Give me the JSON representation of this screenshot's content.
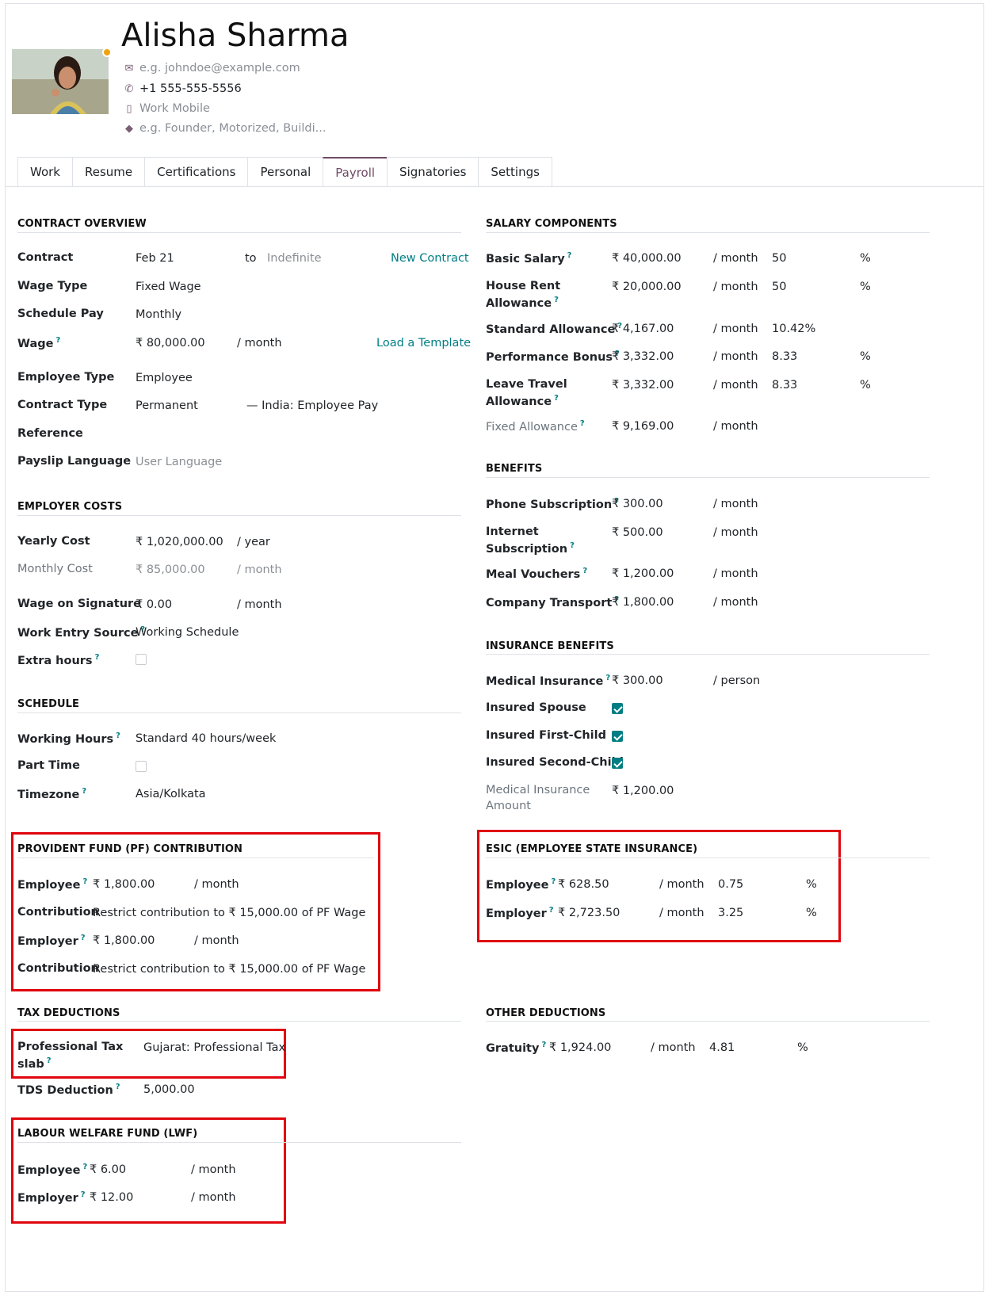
{
  "employee": {
    "name": "Alisha Sharma",
    "email_placeholder": "e.g. johndoe@example.com",
    "phone": "+1 555-555-5556",
    "mobile_placeholder": "Work Mobile",
    "tags_placeholder": "e.g. Founder, Motorized, Buildi..."
  },
  "tabs": [
    "Work",
    "Resume",
    "Certifications",
    "Personal",
    "Payroll",
    "Signatories",
    "Settings"
  ],
  "active_tab": "Payroll",
  "contract_overview": {
    "title": "CONTRACT OVERVIEW",
    "contract_label": "Contract",
    "contract_start": "Feb 21",
    "to": "to",
    "contract_end": "Indefinite",
    "new_contract": "New Contract",
    "wage_type_label": "Wage Type",
    "wage_type": "Fixed Wage",
    "schedule_pay_label": "Schedule Pay",
    "schedule_pay": "Monthly",
    "wage_label": "Wage",
    "wage": "₹ 80,000.00",
    "wage_unit": "/ month",
    "load_template": "Load a Template",
    "employee_type_label": "Employee Type",
    "employee_type": "Employee",
    "contract_type_label": "Contract Type",
    "contract_type": "Permanent",
    "structure": "India: Employee Pay",
    "reference_label": "Reference",
    "payslip_language_label": "Payslip Language",
    "payslip_language": "User Language"
  },
  "employer_costs": {
    "title": "EMPLOYER COSTS",
    "yearly_cost_label": "Yearly Cost",
    "yearly_cost": "₹ 1,020,000.00",
    "yearly_unit": "/ year",
    "monthly_cost_label": "Monthly Cost",
    "monthly_cost": "₹ 85,000.00",
    "monthly_unit": "/ month",
    "wage_on_signature_label": "Wage on Signature",
    "wage_on_signature": "₹ 0.00",
    "wage_on_signature_unit": "/ month",
    "work_entry_source_label": "Work Entry Source",
    "work_entry_source": "Working Schedule",
    "extra_hours_label": "Extra hours",
    "extra_hours": false
  },
  "schedule": {
    "title": "SCHEDULE",
    "working_hours_label": "Working Hours",
    "working_hours": "Standard 40 hours/week",
    "part_time_label": "Part Time",
    "part_time": false,
    "timezone_label": "Timezone",
    "timezone": "Asia/Kolkata"
  },
  "pf": {
    "title": "PROVIDENT FUND (PF) CONTRIBUTION",
    "employee_label": "Employee",
    "employee": "₹ 1,800.00",
    "employee_unit": "/ month",
    "contribution_label": "Contribution",
    "contribution_1": "Restrict contribution to ₹ 15,000.00 of PF Wage",
    "employer_label": "Employer",
    "employer": "₹ 1,800.00",
    "employer_unit": "/ month",
    "contribution_2": "Restrict contribution to ₹ 15,000.00 of PF Wage"
  },
  "tax": {
    "title": "TAX DEDUCTIONS",
    "pt_label_1": "Professional Tax",
    "pt_label_2": "slab",
    "pt_value": "Gujarat: Professional Tax",
    "tds_label": "TDS Deduction",
    "tds_value": "5,000.00"
  },
  "lwf": {
    "title": "LABOUR WELFARE FUND (LWF)",
    "employee_label": "Employee",
    "employee": "₹ 6.00",
    "employee_unit": "/ month",
    "employer_label": "Employer",
    "employer": "₹ 12.00",
    "employer_unit": "/ month"
  },
  "salary_components": {
    "title": "SALARY COMPONENTS",
    "rows": [
      {
        "label": "Basic Salary",
        "amount": "₹ 40,000.00",
        "unit": "/ month",
        "rate": "50",
        "pct": "%"
      },
      {
        "label": "House Rent",
        "label2": "Allowance",
        "amount": "₹ 20,000.00",
        "unit": "/ month",
        "rate": "50",
        "pct": "%"
      },
      {
        "label": "Standard Allowance",
        "amount": "₹ 4,167.00",
        "unit": "/ month",
        "rate": "10.42%"
      },
      {
        "label": "Performance Bonus",
        "amount": "₹ 3,332.00",
        "unit": "/ month",
        "rate": "8.33",
        "pct": "%"
      },
      {
        "label": "Leave Travel",
        "label2": "Allowance",
        "amount": "₹ 3,332.00",
        "unit": "/ month",
        "rate": "8.33",
        "pct": "%"
      },
      {
        "label": "Fixed Allowance",
        "amount": "₹ 9,169.00",
        "unit": "/ month"
      }
    ]
  },
  "benefits": {
    "title": "BENEFITS",
    "rows": [
      {
        "label": "Phone Subscription",
        "amount": "₹ 300.00",
        "unit": "/ month"
      },
      {
        "label": "Internet",
        "label2": "Subscription",
        "amount": "₹ 500.00",
        "unit": "/ month"
      },
      {
        "label": "Meal Vouchers",
        "amount": "₹ 1,200.00",
        "unit": "/ month"
      },
      {
        "label": "Company Transport",
        "amount": "₹ 1,800.00",
        "unit": "/ month"
      }
    ]
  },
  "insurance": {
    "title": "INSURANCE BENEFITS",
    "medical_label": "Medical Insurance",
    "medical": "₹ 300.00",
    "medical_unit": "/ person",
    "spouse_label": "Insured Spouse",
    "spouse": true,
    "first_child_label": "Insured First-Child",
    "first_child": true,
    "second_child_label": "Insured Second-Child",
    "second_child": true,
    "amount_label_1": "Medical Insurance",
    "amount_label_2": "Amount",
    "amount": "₹ 1,200.00"
  },
  "esic": {
    "title": "ESIC (EMPLOYEE STATE INSURANCE)",
    "employee_label": "Employee",
    "employee": "₹ 628.50",
    "employee_unit": "/ month",
    "employee_rate": "0.75",
    "employer_label": "Employer",
    "employer": "₹ 2,723.50",
    "employer_unit": "/ month",
    "employer_rate": "3.25",
    "pct": "%"
  },
  "other_deductions": {
    "title": "OTHER DEDUCTIONS",
    "gratuity_label": "Gratuity",
    "gratuity": "₹ 1,924.00",
    "gratuity_unit": "/ month",
    "gratuity_rate": "4.81",
    "pct": "%"
  },
  "colors": {
    "accent": "#017e84",
    "tab_active": "#714b67",
    "highlight": "#e0050e",
    "status_dot": "#f0a30a"
  },
  "help_marker": "?"
}
